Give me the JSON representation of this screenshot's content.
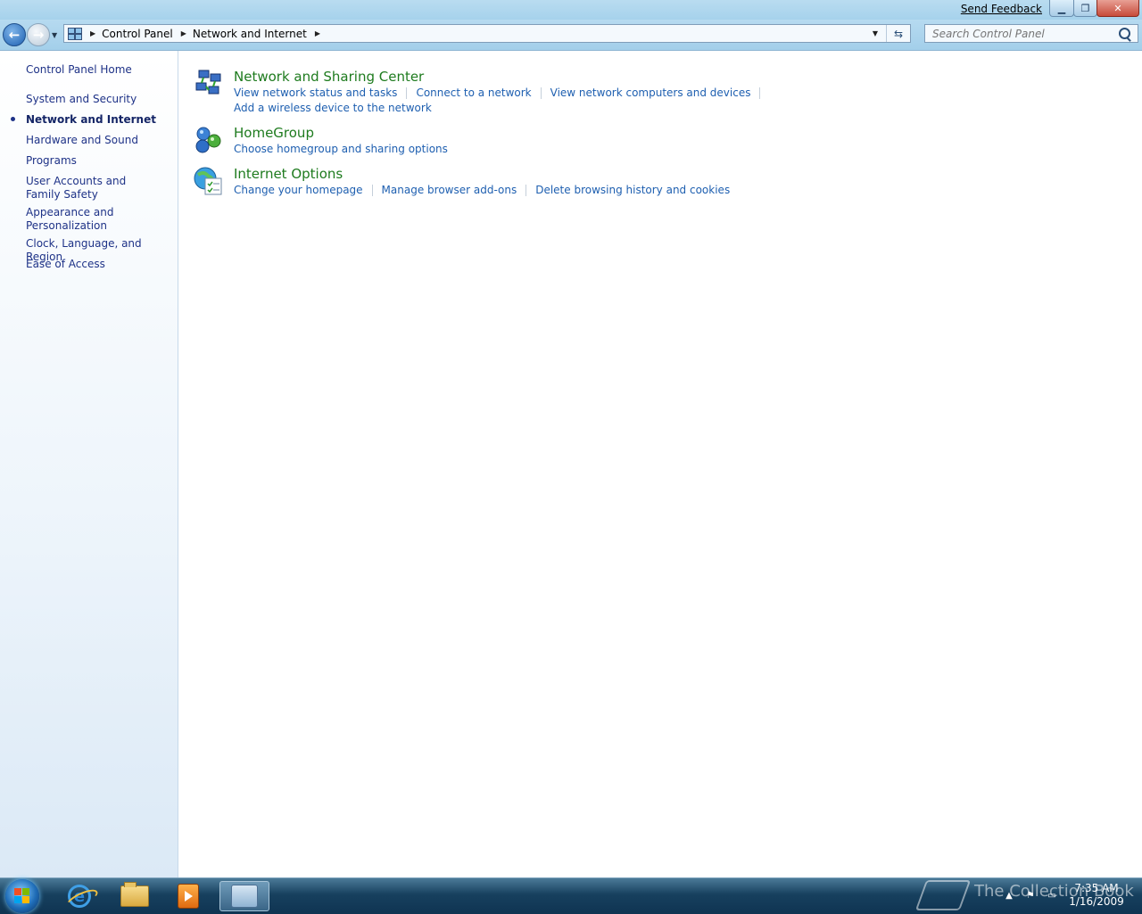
{
  "titlebar": {
    "feedback_label": "Send Feedback",
    "minimize_glyph": "▁",
    "maximize_glyph": "❐",
    "close_glyph": "✕"
  },
  "navigation": {
    "back_glyph": "←",
    "forward_glyph": "→",
    "recent_glyph": "▼",
    "breadcrumbs": [
      "Control Panel",
      "Network and Internet"
    ],
    "separator_glyph": "▶",
    "dropdown_glyph": "▼",
    "refresh_glyph": "⇆",
    "search_placeholder": "Search Control Panel"
  },
  "sidebar": {
    "home": "Control Panel Home",
    "items": [
      {
        "label": "System and Security",
        "active": false
      },
      {
        "label": "Network and Internet",
        "active": true
      },
      {
        "label": "Hardware and Sound",
        "active": false
      },
      {
        "label": "Programs",
        "active": false
      },
      {
        "label": "User Accounts and Family Safety",
        "active": false
      },
      {
        "label": "Appearance and Personalization",
        "active": false
      },
      {
        "label": "Clock, Language, and Region",
        "active": false
      },
      {
        "label": "Ease of Access",
        "active": false
      }
    ]
  },
  "categories": [
    {
      "title": "Network and Sharing Center",
      "icon": "network-sharing-icon",
      "tasks": [
        "View network status and tasks",
        "Connect to a network",
        "View network computers and devices",
        "Add a wireless device to the network"
      ]
    },
    {
      "title": "HomeGroup",
      "icon": "homegroup-icon",
      "tasks": [
        "Choose homegroup and sharing options"
      ]
    },
    {
      "title": "Internet Options",
      "icon": "internet-options-icon",
      "tasks": [
        "Change your homepage",
        "Manage browser add-ons",
        "Delete browsing history and cookies"
      ]
    }
  ],
  "taskbar": {
    "pinned": [
      "internet-explorer-icon",
      "windows-explorer-icon",
      "media-player-icon",
      "control-panel-icon"
    ],
    "active_app": "control-panel-icon",
    "watermark": "The Collection Book",
    "tray_show_glyph": "▲",
    "time": "7:35 AM",
    "date": "1/16/2009"
  },
  "colors": {
    "link": "#1e5fb0",
    "category_title": "#1e7b1e",
    "sidebar_link": "#1e3287"
  }
}
